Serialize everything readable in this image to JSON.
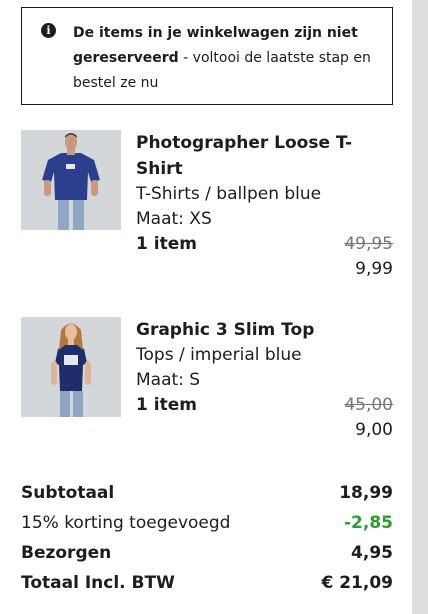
{
  "notice": {
    "icon": "info-icon",
    "bold_text": "De items in je winkelwagen zijn niet gereserveerd",
    "rest_text": " - voltooi de laatste stap en bestel ze nu"
  },
  "items": [
    {
      "name": "Photographer Loose T-Shirt",
      "category": "T-Shirts / ballpen blue",
      "size": "Maat: XS",
      "quantity": "1 item",
      "old_price": "49,95",
      "price": "9,99"
    },
    {
      "name": "Graphic 3 Slim Top",
      "category": "Tops / imperial blue",
      "size": "Maat: S",
      "quantity": "1 item",
      "old_price": "45,00",
      "price": "9,00"
    }
  ],
  "totals": {
    "subtotal_label": "Subtotaal",
    "subtotal_value": "18,99",
    "discount_label": "15% korting toegevoegd",
    "discount_value": "-2,85",
    "shipping_label": "Bezorgen",
    "shipping_value": "4,95",
    "total_label": "Totaal Incl. BTW",
    "total_value": "€ 21,09"
  },
  "colors": {
    "discount": "#2a9d2f",
    "text": "#1d1d1d",
    "old_price": "#777777"
  }
}
